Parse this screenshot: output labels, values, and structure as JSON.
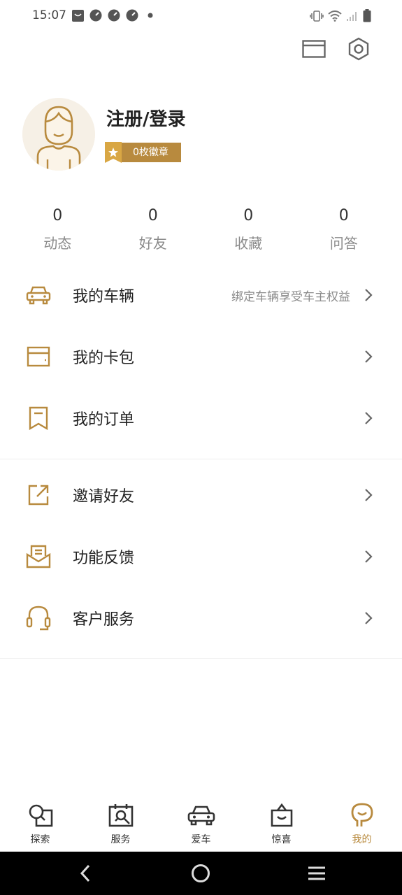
{
  "status_bar": {
    "time": "15:07",
    "notification_icons": [
      "message-icon",
      "gauge-icon",
      "gauge-icon",
      "gauge-icon",
      "dot-icon"
    ],
    "right_icons": [
      "vibrate-icon",
      "wifi-icon",
      "signal-icon",
      "battery-icon"
    ]
  },
  "top_actions": {
    "messages_icon": "envelope-icon",
    "settings_icon": "hexagon-gear-icon"
  },
  "profile": {
    "login_label": "注册/登录",
    "badge_label": "0枚徽章"
  },
  "stats": [
    {
      "value": "0",
      "label": "动态"
    },
    {
      "value": "0",
      "label": "好友"
    },
    {
      "value": "0",
      "label": "收藏"
    },
    {
      "value": "0",
      "label": "问答"
    }
  ],
  "menu_group_1": [
    {
      "label": "我的车辆",
      "hint": "绑定车辆享受车主权益",
      "icon": "car-icon"
    },
    {
      "label": "我的卡包",
      "hint": "",
      "icon": "card-icon"
    },
    {
      "label": "我的订单",
      "hint": "",
      "icon": "bookmark-icon"
    }
  ],
  "menu_group_2": [
    {
      "label": "邀请好友",
      "hint": "",
      "icon": "share-icon"
    },
    {
      "label": "功能反馈",
      "hint": "",
      "icon": "inbox-icon"
    },
    {
      "label": "客户服务",
      "hint": "",
      "icon": "headset-icon"
    }
  ],
  "tabs": [
    {
      "label": "探索",
      "icon": "explore-icon",
      "active": false
    },
    {
      "label": "服务",
      "icon": "service-icon",
      "active": false
    },
    {
      "label": "爱车",
      "icon": "car-icon",
      "active": false
    },
    {
      "label": "惊喜",
      "icon": "shopping-bag-icon",
      "active": false
    },
    {
      "label": "我的",
      "icon": "profile-icon",
      "active": true
    }
  ],
  "colors": {
    "accent": "#b88a3e",
    "text": "#222222",
    "muted": "#8a8a8a",
    "navbar": "#000000"
  }
}
